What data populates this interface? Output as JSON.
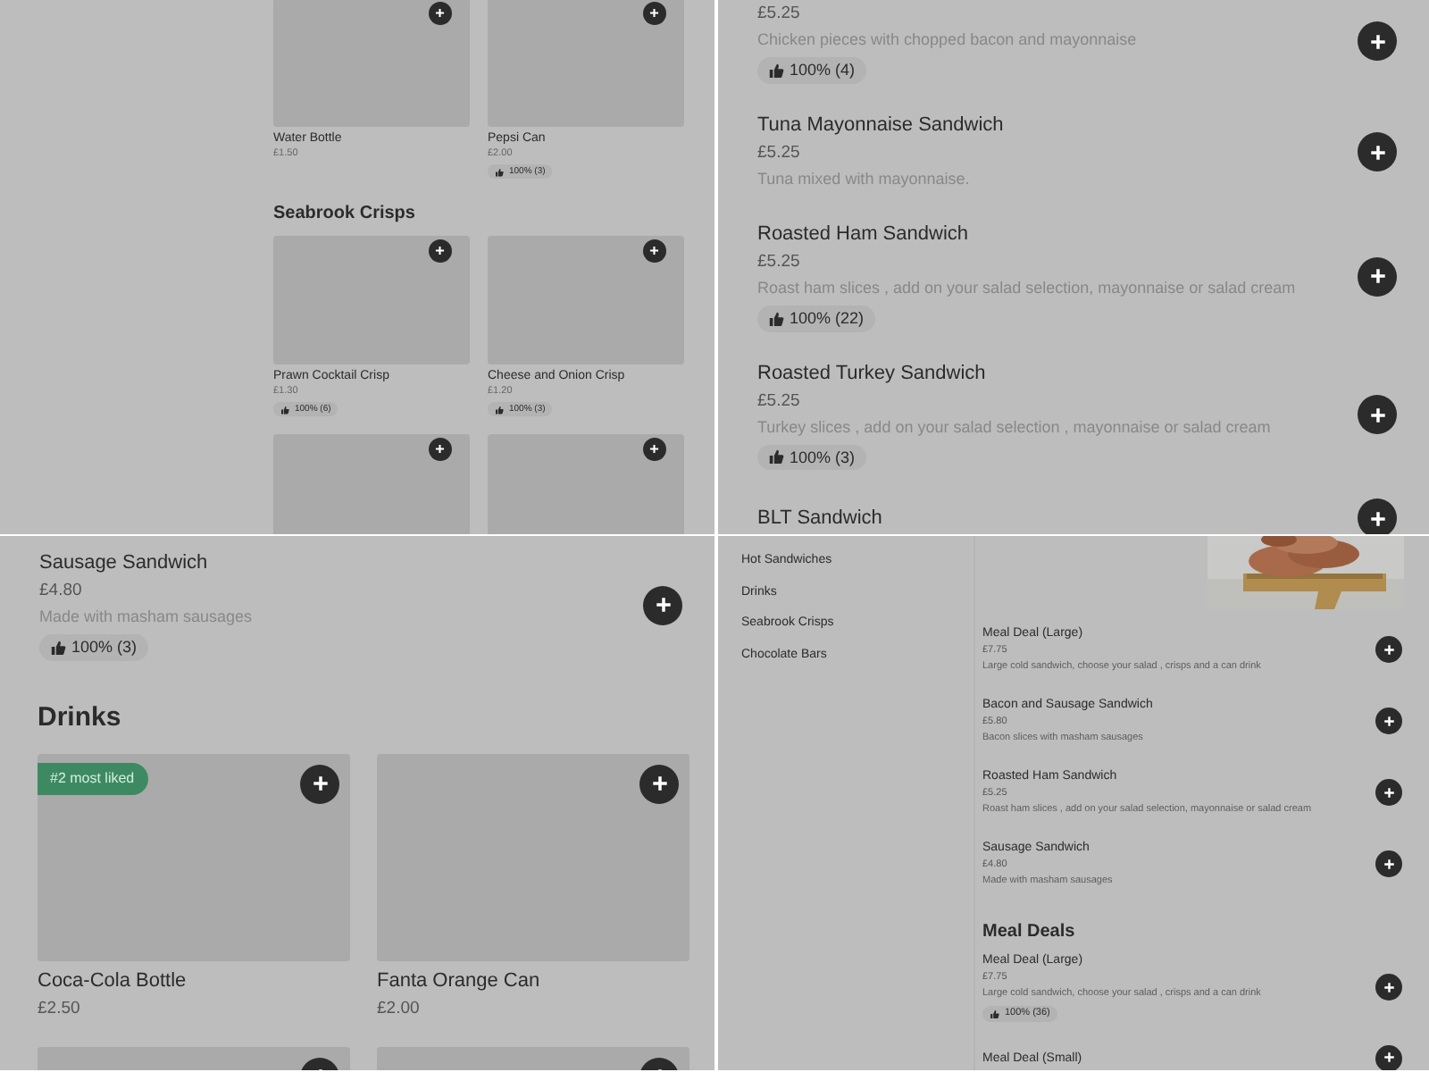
{
  "panels": [
    {
      "kind": "cards",
      "blocks": [
        {
          "kind": "cards",
          "cards": [
            {
              "name": "Water Bottle",
              "price": "£1.50"
            },
            {
              "name": "Pepsi Can",
              "price": "£2.00",
              "rating": "100% (3)"
            }
          ]
        },
        {
          "kind": "heading",
          "text": "Seabrook Crisps"
        },
        {
          "kind": "cards",
          "cards": [
            {
              "name": "Prawn Cocktail Crisp",
              "price": "£1.30",
              "rating": "100% (6)"
            },
            {
              "name": "Cheese and Onion Crisp",
              "price": "£1.20",
              "rating": "100% (3)"
            }
          ]
        },
        {
          "kind": "image_row"
        }
      ]
    },
    {
      "kind": "list",
      "blocks": [
        {
          "kind": "item",
          "price": "£5.25",
          "description": "Chicken pieces with chopped bacon and mayonnaise",
          "rating": "100% (4)"
        },
        {
          "kind": "item",
          "name": "Tuna Mayonnaise Sandwich",
          "price": "£5.25",
          "description": "Tuna mixed with mayonnaise."
        },
        {
          "kind": "item",
          "name": "Roasted Ham Sandwich",
          "price": "£5.25",
          "description": "Roast ham slices , add on your salad selection, mayonnaise or salad cream",
          "rating": "100% (22)"
        },
        {
          "kind": "item",
          "name": "Roasted Turkey Sandwich",
          "price": "£5.25",
          "description": "Turkey slices , add on your salad selection , mayonnaise or salad cream",
          "rating": "100% (3)"
        },
        {
          "kind": "item",
          "name": "BLT Sandwich"
        }
      ]
    },
    {
      "kind": "list",
      "blocks": [
        {
          "kind": "item",
          "name": "Sausage Sandwich",
          "price": "£4.80",
          "description": "Made with masham sausages",
          "rating": "100% (3)"
        },
        {
          "kind": "heading",
          "text": "Drinks"
        },
        {
          "kind": "cards",
          "cards": [
            {
              "name": "Coca-Cola Bottle",
              "price": "£2.50",
              "badge": "#2 most liked"
            },
            {
              "name": "Fanta Orange Can",
              "price": "£2.00"
            }
          ]
        },
        {
          "kind": "image_row"
        }
      ]
    },
    {
      "kind": "menu",
      "sidebar": {
        "items": [
          {
            "label": "Hot Sandwiches"
          },
          {
            "label": "Drinks"
          },
          {
            "label": "Seabrook Crisps"
          },
          {
            "label": "Chocolate Bars"
          }
        ]
      },
      "blocks": [
        {
          "kind": "picture"
        },
        {
          "kind": "item",
          "name": "Meal Deal (Large)",
          "price": "£7.75",
          "description": "Large cold sandwich, choose your salad , crisps and a can drink"
        },
        {
          "kind": "item",
          "name": "Bacon and Sausage Sandwich",
          "price": "£5.80",
          "description": "Bacon slices with masham sausages"
        },
        {
          "kind": "item",
          "name": "Roasted Ham Sandwich",
          "price": "£5.25",
          "description": "Roast ham slices , add on your salad selection, mayonnaise or salad cream"
        },
        {
          "kind": "item",
          "name": "Sausage Sandwich",
          "price": "£4.80",
          "description": "Made with masham sausages"
        },
        {
          "kind": "heading",
          "text": "Meal Deals"
        },
        {
          "kind": "item",
          "name": "Meal Deal (Large)",
          "price": "£7.75",
          "description": "Large cold sandwich, choose your salad , crisps and a can drink",
          "rating": "100% (36)"
        },
        {
          "kind": "item",
          "name": "Meal Deal (Small)"
        }
      ]
    }
  ]
}
